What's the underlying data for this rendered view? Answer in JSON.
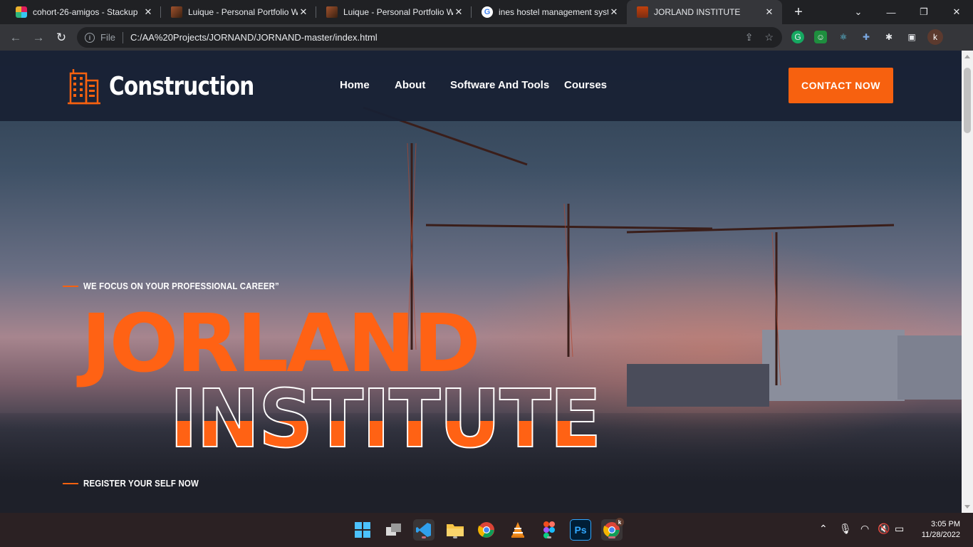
{
  "browser": {
    "tabs": [
      {
        "title": "cohort-26-amigos - Stackup",
        "icon": "slack-icon"
      },
      {
        "title": "Luique - Personal Portfolio W",
        "icon": "portfolio-icon"
      },
      {
        "title": "Luique - Personal Portfolio W",
        "icon": "portfolio-icon"
      },
      {
        "title": "ines hostel management syst",
        "icon": "google-icon"
      },
      {
        "title": "JORLAND INSTITUTE",
        "icon": "building-icon"
      }
    ],
    "active_tab": 4,
    "address": {
      "scheme": "File",
      "url": "C:/AA%20Projects/JORNAND/JORNAND-master/index.html"
    },
    "profile_initial": "k",
    "google_glyph": "G"
  },
  "site": {
    "brand": "Construction",
    "nav": [
      "Home",
      "About",
      "Software And Tools",
      "Courses"
    ],
    "cta": "CONTACT NOW",
    "tagline_top": "WE FOCUS ON YOUR PROFESSIONAL CAREER”",
    "headline_1": "JORLAND",
    "headline_2": "INSTITUTE",
    "tagline_bottom": "REGISTER YOUR SELF NOW",
    "accent_color": "#f7610f",
    "header_color": "#182134"
  },
  "taskbar": {
    "apps": [
      "windows-start-icon",
      "task-view-icon",
      "vscode-icon",
      "file-explorer-icon",
      "chrome-icon",
      "vlc-icon",
      "figma-icon",
      "photoshop-icon",
      "chrome-profile-icon"
    ],
    "ps_label": "Ps",
    "profile_badge": "k",
    "time": "3:05 PM",
    "date": "11/28/2022"
  }
}
